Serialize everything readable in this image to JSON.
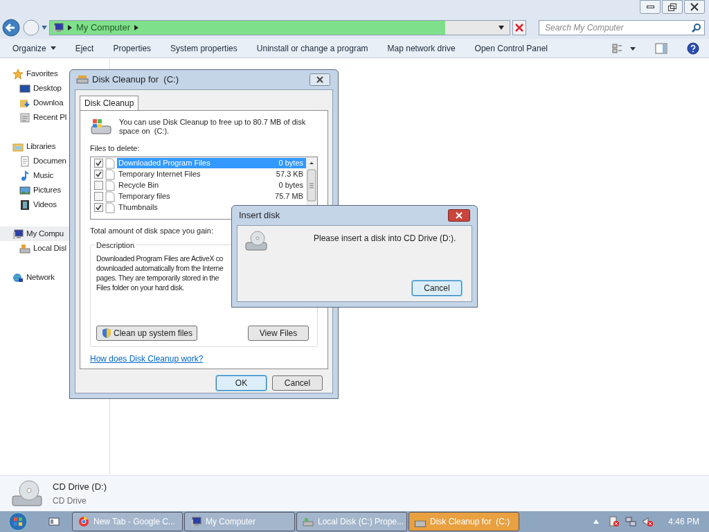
{
  "explorer": {
    "address_bar": {
      "path": "My Computer",
      "level": 0.86
    },
    "search": {
      "placeholder": "Search My Computer"
    },
    "toolbar": [
      {
        "label": "Organize",
        "dropdown": true
      },
      {
        "label": "Eject",
        "dropdown": false
      },
      {
        "label": "Properties",
        "dropdown": false
      },
      {
        "label": "System properties",
        "dropdown": false
      },
      {
        "label": "Uninstall or change a program",
        "dropdown": false
      },
      {
        "label": "Map network drive",
        "dropdown": false
      },
      {
        "label": "Open Control Panel",
        "dropdown": false
      }
    ],
    "sidebar": [
      {
        "label": "Favorites",
        "kind": "star",
        "selected": false,
        "children": [
          {
            "label": "Desktop",
            "kind": "desktop",
            "selected": false
          },
          {
            "label": "Downloa",
            "kind": "download",
            "selected": false
          },
          {
            "label": "Recent Pl",
            "kind": "recent",
            "selected": false
          }
        ]
      },
      {
        "label": "Libraries",
        "kind": "library",
        "selected": false,
        "children": [
          {
            "label": "Documen",
            "kind": "document",
            "selected": false
          },
          {
            "label": "Music",
            "kind": "music",
            "selected": false
          },
          {
            "label": "Pictures",
            "kind": "pictures",
            "selected": false
          },
          {
            "label": "Videos",
            "kind": "videos",
            "selected": false
          }
        ]
      },
      {
        "label": "My Compu",
        "kind": "computer",
        "selected": true,
        "children": [
          {
            "label": "Local Disl",
            "kind": "disk",
            "selected": false
          }
        ]
      },
      {
        "label": "Network",
        "kind": "network",
        "selected": false
      }
    ],
    "details": {
      "name": "CD Drive (D:)",
      "type": "CD Drive"
    }
  },
  "disk_cleanup": {
    "title": "Disk Cleanup for  (C:)",
    "tab": {
      "label": "Disk Cleanup",
      "selected": true
    },
    "intro": "You can use Disk Cleanup to free up to 80.7 MB of disk space on  (C:).",
    "files_label": "Files to delete:",
    "files": [
      {
        "name": "Downloaded Program Files",
        "size": "0 bytes",
        "checked": true,
        "selected": true
      },
      {
        "name": "Temporary Internet Files",
        "size": "57.3 KB",
        "checked": true,
        "selected": false
      },
      {
        "name": "Recycle Bin",
        "size": "0 bytes",
        "checked": false,
        "selected": false
      },
      {
        "name": "Temporary files",
        "size": "75.7 MB",
        "checked": false,
        "selected": false
      },
      {
        "name": "Thumbnails",
        "checked": true,
        "selected": false
      }
    ],
    "total_label": "Total amount of disk space you gain:",
    "description": {
      "legend": "Description",
      "lines": [
        "Downloaded Program Files are ActiveX co",
        "downloaded automatically from the Interne",
        "pages. They are temporarily stored in the",
        "Files folder on your hard disk."
      ]
    },
    "clean_button": "Clean up system files",
    "view_button": "View Files",
    "help_link": "How does Disk Cleanup work?",
    "ok_button": "OK",
    "cancel_button": "Cancel"
  },
  "insert_disk": {
    "title": "Insert disk",
    "message": "Please insert a disk into CD Drive (D:).",
    "cancel_button": "Cancel"
  },
  "taskbar": {
    "items": [
      {
        "label": "New Tab - Google C...",
        "kind": "browser",
        "selected": false
      },
      {
        "label": "My Computer",
        "kind": "computer",
        "selected": false
      },
      {
        "label": "Local Disk (C:) Prope...",
        "kind": "disk",
        "selected": false
      },
      {
        "label": "Disk Cleanup for  (C:)",
        "kind": "cleanup",
        "selected": true
      }
    ],
    "clock": "4:46 PM"
  }
}
